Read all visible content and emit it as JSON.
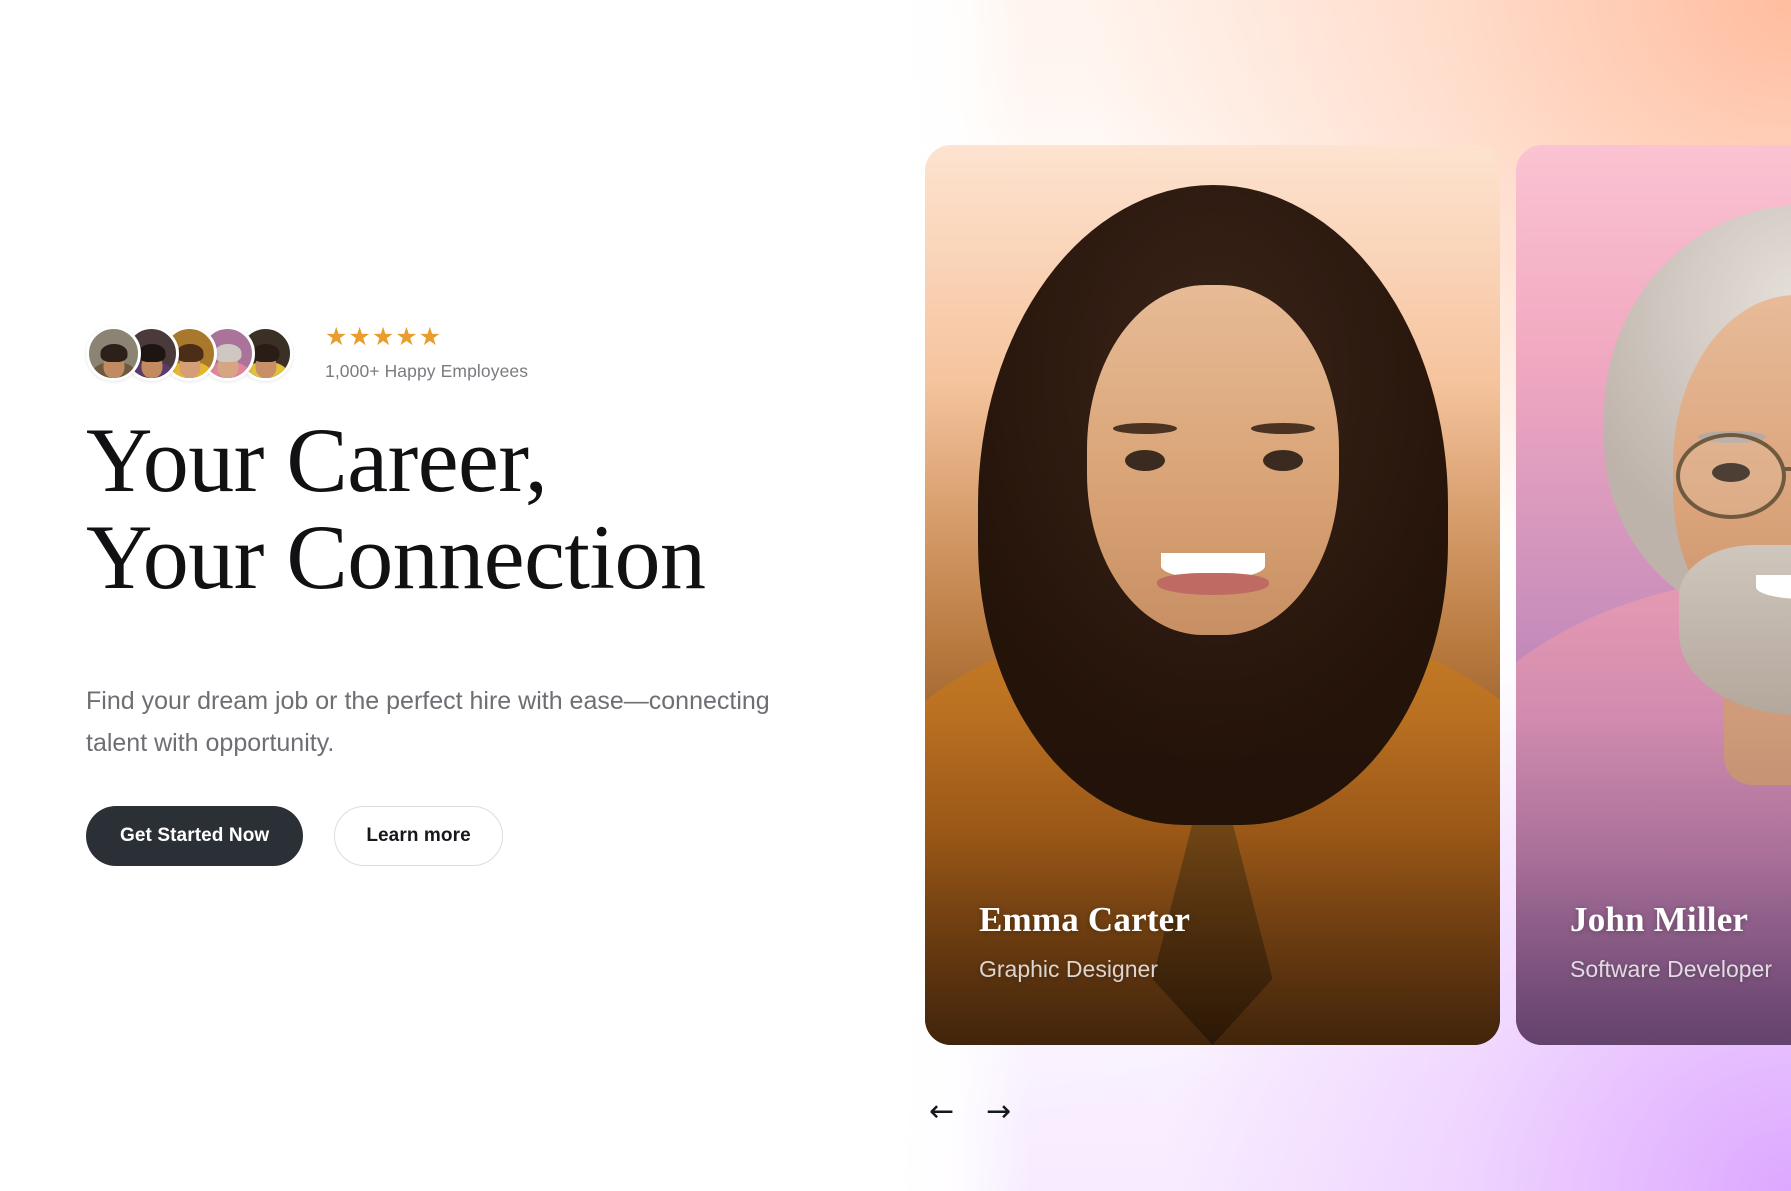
{
  "theme": {
    "star_color": "#e89d2c",
    "primary_button_bg": "#2b2f36",
    "headline_color": "#111114",
    "muted_text_color": "#6e6e74",
    "card_one_gradient_top": "#fde3d0",
    "card_two_gradient_top": "#fbc3d2",
    "panel_peach": "#ffba9b",
    "panel_lavender": "#daa0ff"
  },
  "hero": {
    "social_proof": {
      "stars": "★★★★★",
      "star_count": 5,
      "caption": "1,000+ Happy Employees",
      "avatars": [
        {
          "name": "avatar-1",
          "skin": "#c08a63",
          "hair": "#2c211a",
          "shirt": "#6d5a3e",
          "bg": "#8b8374"
        },
        {
          "name": "avatar-2",
          "skin": "#c28a5f",
          "hair": "#1d1512",
          "shirt": "#5b3a6e",
          "bg": "#4a3a3c"
        },
        {
          "name": "avatar-3",
          "skin": "#d49f76",
          "hair": "#4a2e17",
          "shirt": "#e5b82b",
          "bg": "#a8782c"
        },
        {
          "name": "avatar-4",
          "skin": "#d6a584",
          "hair": "#cfc7c2",
          "shirt": "#e0859a",
          "bg": "#a9739a"
        },
        {
          "name": "avatar-5",
          "skin": "#c79066",
          "hair": "#2a1d16",
          "shirt": "#e3c23a",
          "bg": "#3b3026"
        }
      ]
    },
    "headline_line_1": "Your Career,",
    "headline_line_2": "Your Connection",
    "subtitle": "Find your dream job or the perfect hire with ease—connecting talent with opportunity.",
    "primary_cta": "Get Started Now",
    "secondary_cta": "Learn more"
  },
  "carousel": {
    "cards": [
      {
        "name": "Emma Carter",
        "role": "Graphic Designer"
      },
      {
        "name": "John Miller",
        "role": "Software Developer"
      }
    ],
    "prev_label": "←",
    "next_label": "→"
  }
}
